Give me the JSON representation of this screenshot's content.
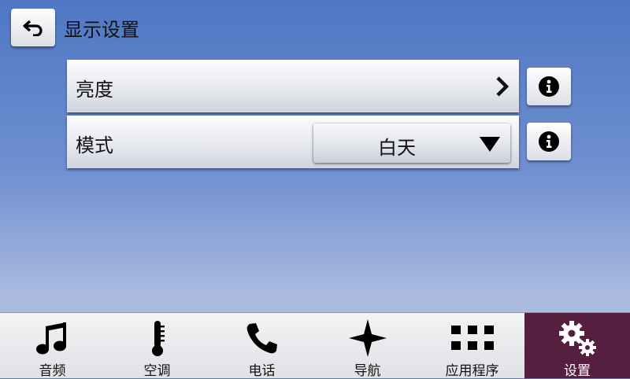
{
  "header": {
    "title": "显示设置",
    "back_icon": "back-arrow-icon"
  },
  "settings": [
    {
      "label": "亮度",
      "control": "chevron-right-icon"
    },
    {
      "label": "模式",
      "control": "dropdown",
      "value": "白天",
      "arrow": "triangle-down-icon"
    }
  ],
  "info_icon": "info-icon",
  "navbar": {
    "active_color": "#551f40",
    "items": [
      {
        "label": "音频",
        "icon": "music-note-icon",
        "active": false
      },
      {
        "label": "空调",
        "icon": "thermometer-icon",
        "active": false
      },
      {
        "label": "电话",
        "icon": "phone-icon",
        "active": false
      },
      {
        "label": "导航",
        "icon": "compass-star-icon",
        "active": false
      },
      {
        "label": "应用程序",
        "icon": "apps-grid-icon",
        "active": false
      },
      {
        "label": "设置",
        "icon": "gears-icon",
        "active": true
      }
    ]
  }
}
